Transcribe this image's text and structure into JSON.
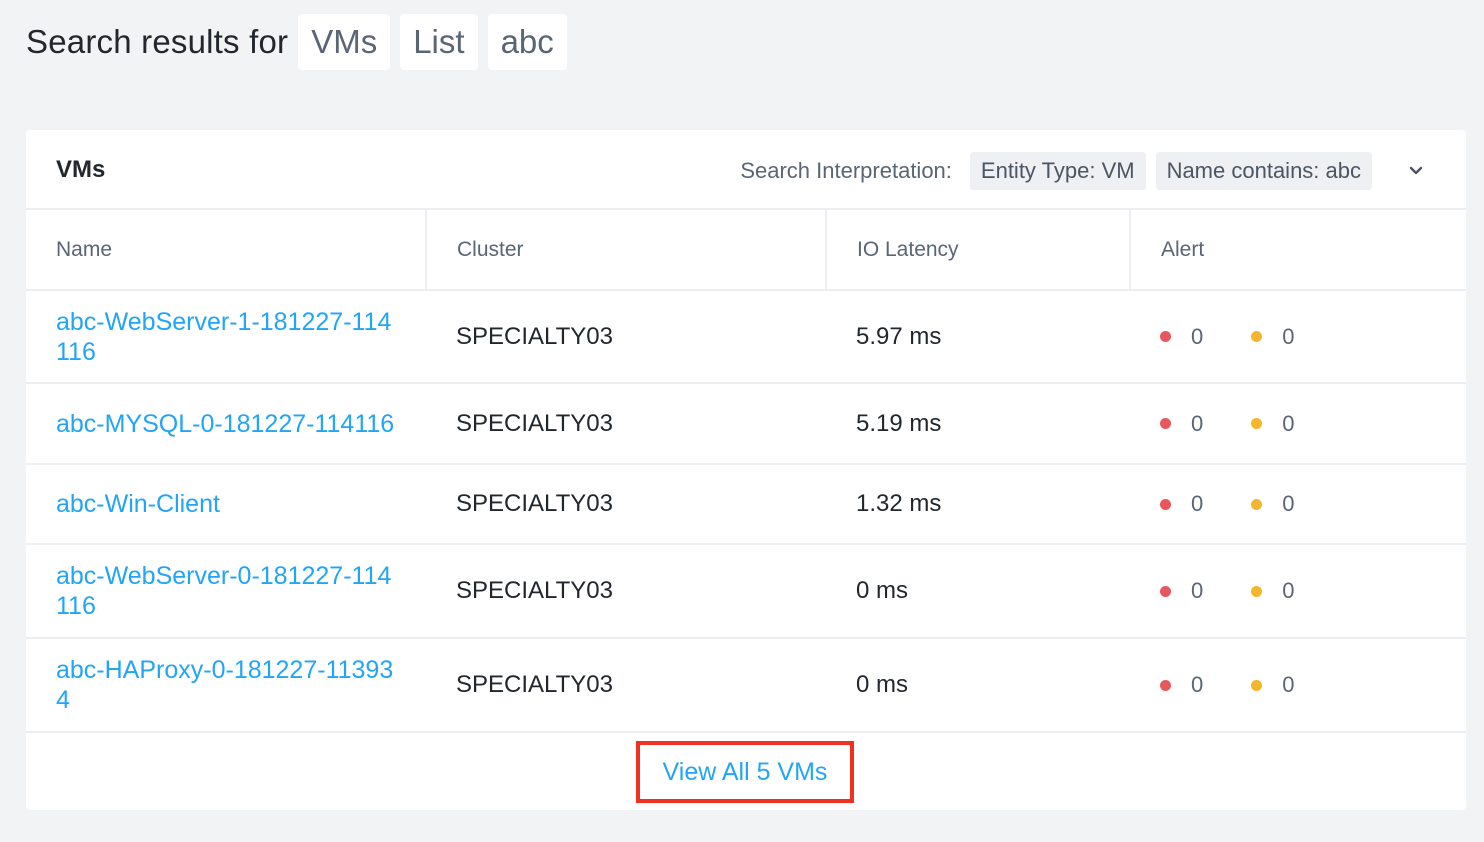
{
  "header": {
    "label": "Search results for",
    "chips": [
      "VMs",
      "List",
      "abc"
    ]
  },
  "card": {
    "title": "VMs",
    "interpretation_label": "Search Interpretation:",
    "interpretation_chips": [
      "Entity Type: VM",
      "Name contains: abc"
    ],
    "expand_icon": "chevron-down-icon"
  },
  "table": {
    "columns": [
      "Name",
      "Cluster",
      "IO Latency",
      "Alert"
    ],
    "rows": [
      {
        "name": "abc-WebServer-1-181227-114116",
        "cluster": "SPECIALTY03",
        "latency": "5.97 ms",
        "critical": "0",
        "warning": "0"
      },
      {
        "name": "abc-MYSQL-0-181227-114116",
        "cluster": "SPECIALTY03",
        "latency": "5.19 ms",
        "critical": "0",
        "warning": "0"
      },
      {
        "name": "abc-Win-Client",
        "cluster": "SPECIALTY03",
        "latency": "1.32 ms",
        "critical": "0",
        "warning": "0"
      },
      {
        "name": "abc-WebServer-0-181227-114116",
        "cluster": "SPECIALTY03",
        "latency": "0 ms",
        "critical": "0",
        "warning": "0"
      },
      {
        "name": "abc-HAProxy-0-181227-113934",
        "cluster": "SPECIALTY03",
        "latency": "0 ms",
        "critical": "0",
        "warning": "0"
      }
    ]
  },
  "footer": {
    "view_all_label": "View All 5 VMs"
  },
  "colors": {
    "link": "#22a5f7",
    "critical": "#e8575e",
    "warning": "#f5b52d",
    "highlight_border": "#f2301f",
    "background": "#f2f3f5"
  }
}
